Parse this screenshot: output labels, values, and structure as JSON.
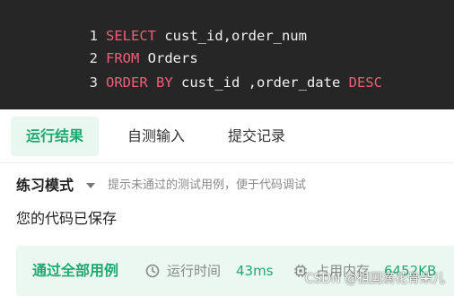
{
  "editor": {
    "lines": [
      {
        "num": "1",
        "parts": [
          {
            "t": "kw",
            "v": "SELECT"
          },
          {
            "t": "id",
            "v": " cust_id,order_num"
          }
        ]
      },
      {
        "num": "2",
        "parts": [
          {
            "t": "kw",
            "v": "FROM"
          },
          {
            "t": "id",
            "v": " Orders"
          }
        ]
      },
      {
        "num": "3",
        "parts": [
          {
            "t": "kw",
            "v": "ORDER BY"
          },
          {
            "t": "id",
            "v": " cust_id ,order_date "
          },
          {
            "t": "kw",
            "v": "DESC"
          }
        ]
      }
    ]
  },
  "tabs": [
    {
      "label": "运行结果",
      "active": true
    },
    {
      "label": "自测输入",
      "active": false
    },
    {
      "label": "提交记录",
      "active": false
    }
  ],
  "mode": {
    "title": "练习模式",
    "hint": "提示未通过的测试用例，便于代码调试"
  },
  "status": {
    "saved": "您的代码已保存"
  },
  "result": {
    "title": "通过全部用例",
    "runtime_label": "运行时间",
    "runtime_value": "43ms",
    "memory_label": "占用内存",
    "memory_value": "6452KB",
    "clock_icon": "clock-icon",
    "memory_icon": "chip-icon"
  },
  "watermark": "CSDN @祖国滴花骨朵儿",
  "colors": {
    "accent": "#1fa870",
    "keyword": "#f45d78",
    "editor_bg": "#262626",
    "result_bg": "#ebf8f2"
  }
}
